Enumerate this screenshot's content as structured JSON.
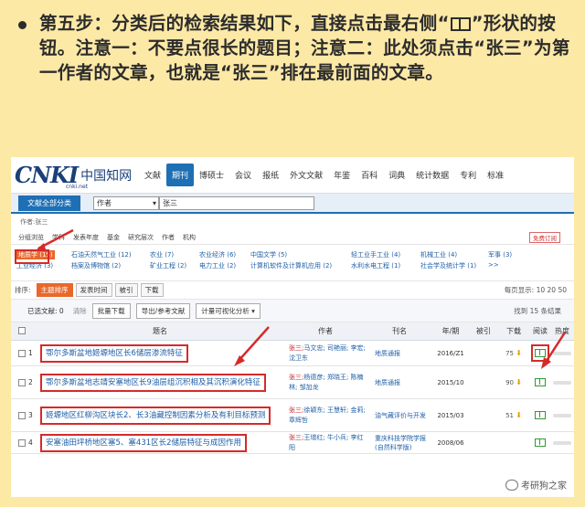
{
  "instruction": {
    "part1": "第五步：分类后的检索结果如下，直接点击最右侧“",
    "part2": "”形状的按钮。注意一：不要点很长的题目；注意二：此处须点击“张三”为第一作者的文章，也就是“张三”排在最前面的文章。",
    "icon": "book-icon"
  },
  "logo": {
    "mark": "CNKI",
    "name": "中国知网",
    "sub": "cnki.net"
  },
  "nav": [
    "文献",
    "期刊",
    "博硕士",
    "会议",
    "报纸",
    "外文文献",
    "年鉴",
    "百科",
    "词典",
    "统计数据",
    "专利",
    "标准"
  ],
  "nav_active_index": 1,
  "search": {
    "scope": "文献全部分类",
    "field": "作者",
    "query": "张三"
  },
  "crumb": "作者:张三",
  "group_tabs": [
    "分组浏览",
    "学科",
    "发表年度",
    "基金",
    "研究层次",
    "作者",
    "机构"
  ],
  "group_right": "免费订阅",
  "categories": [
    "地质学 (15)",
    "石油天然气工业 (12)",
    "农业 (7)",
    "农业经济 (6)",
    "中国文学 (5)",
    "轻工业手工业 (4)",
    "机械工业 (4)",
    "军事 (3)",
    "工业经济 (3)",
    "档案及博物馆 (2)",
    "矿业工程 (2)",
    "电力工业 (2)",
    "计算机软件及计算机应用 (2)",
    "水利水电工程 (1)",
    "社会学及统计学 (1)",
    ">>"
  ],
  "toolbar": {
    "sort_label": "排序:",
    "buttons": [
      "主题排序",
      "发表时间",
      "被引",
      "下载"
    ],
    "active": 0,
    "page_info": "每页显示: 10 20 50"
  },
  "selection": {
    "selected_label": "已选文献: 0",
    "clear": "清除",
    "batch": "批量下载",
    "export": "导出/参考文献",
    "analyze": "计量可视化分析",
    "found": "找到 15 条结果"
  },
  "table": {
    "headers": [
      "题名",
      "作者",
      "刊名",
      "年/期",
      "被引",
      "下载",
      "阅读",
      "热度"
    ],
    "rows": [
      {
        "no": "1",
        "title": "鄂尔多斯盆地姬塬地区长6储层渗流特征",
        "first_author": "张三;",
        "other_authors": "马文忠; 司艳丽; 李宏; 沈卫东",
        "source": "地质通报",
        "date": "2016/Z1",
        "cite": "",
        "downloads": "75"
      },
      {
        "no": "2",
        "title": "鄂尔多斯盆地志靖安塞地区长9油层组沉积相及其沉积演化特征",
        "first_author": "张三;",
        "other_authors": "杨德彦; 郑晓王; 陈楠林; 邹加龙",
        "source": "地质通报",
        "date": "2015/10",
        "cite": "",
        "downloads": "90"
      },
      {
        "no": "3",
        "title": "姬塬地区红柳沟区块长2、长3油藏控制因素分析及有利目标预测",
        "first_author": "张三;",
        "other_authors": "徐颖东; 王慧轩; 金莉; 章辉哲",
        "source": "油气藏评价与开发",
        "date": "2015/03",
        "cite": "",
        "downloads": "51"
      },
      {
        "no": "4",
        "title": "安塞油田坪桥地区塞5、塞431区长2储层特征与成因作用",
        "first_author": "张三;",
        "other_authors": "王增红; 牛小兵; 李红阳",
        "source": "重庆科技学院学报(自然科学版)",
        "date": "2008/06",
        "cite": "",
        "downloads": ""
      }
    ]
  },
  "watermark": "考研狗之家"
}
